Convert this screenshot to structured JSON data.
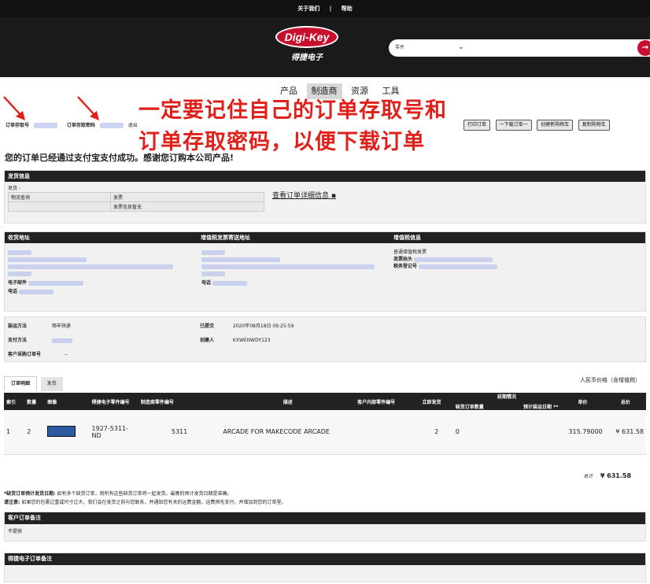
{
  "topbar": {
    "about": "关于我们",
    "sep": "|",
    "help": "帮助"
  },
  "logo": {
    "brand": "Digi-Key",
    "sub": "得捷电子"
  },
  "search": {
    "category": "零件",
    "chevron": "⌄",
    "button": "→"
  },
  "nav": {
    "items": [
      "产品",
      "制造商",
      "资源",
      "工具"
    ]
  },
  "annotation": {
    "line1": "一定要记住自己的订单存取号和",
    "line2": "订单存取密码，以便下载订单"
  },
  "account": {
    "order_access_label": "订单存取号",
    "order_password_label": "订单存取密码",
    "logout": "退出"
  },
  "actions": {
    "print": "打印订单",
    "download": "一下载订单一",
    "create_cart": "创建新购物车",
    "copy_cart": "复制购物车"
  },
  "success_message": "您的订单已经通过支付宝支付成功。感谢您订购本公司产品!",
  "shipping_info": {
    "header": "发货信息",
    "row1": "发货 -",
    "logistics": "物流查询",
    "invoice": "发票",
    "invoice_none": "发票信息暂无",
    "detail_link": "查看订单详细信息"
  },
  "address": {
    "headers": [
      "收货地址",
      "增值税发票寄送地址",
      "增值税信息"
    ],
    "email_label": "电子邮件",
    "phone_label": "电话",
    "phone2_label": "电话",
    "vat_type": "普通增值税发票",
    "invoice_title_label": "发票抬头",
    "tax_id_label": "税务登记号"
  },
  "order_meta": {
    "ship_method_label": "装运方法",
    "ship_method": "顺丰快递",
    "pay_method_label": "支付方法",
    "submitted_label": "已提交",
    "submitted": "2020年08月18日 09:25:59",
    "creator_label": "创建人",
    "creator": "KXWENWDY123",
    "po_label": "客户采购订单号",
    "po": "--"
  },
  "tabs": [
    "订单明细",
    "发货"
  ],
  "currency_note": "人民币价格（含增值税）",
  "table": {
    "headers": [
      "索引",
      "数量",
      "图像",
      "得捷电子零件编号",
      "制造商零件编号",
      "描述",
      "客户内部零件编号",
      "立即发货",
      "延期情况",
      "单价",
      "总价"
    ],
    "sub_headers": [
      "缺货订单数量",
      "预计装运日期 **"
    ],
    "rows": [
      {
        "index": "1",
        "qty": "2",
        "dk_part": "1927-5311-ND",
        "mfr_part": "5311",
        "desc": "ARCADE FOR MAKECODE ARCADE",
        "ship_now": "2",
        "backorder": "0",
        "unit": "315.79000",
        "total": "¥ 631.58"
      }
    ]
  },
  "grand_total": {
    "label": "总计",
    "value": "¥ 631.58"
  },
  "notes": {
    "backorder_label": "*缺货订单预计发货日期:",
    "backorder_text": "如有多个缺货订单，则所有这些缺货订单将一起发货。最晚的预计发货日期是准确。",
    "attention_label": "请注意:",
    "attention_text": "如果您的包裹过重或尺寸过大，我们会在发货之前与您联系，并通知您有关的运费金额。运费预先支付，并增加到您的订单里。"
  },
  "customer_notes": {
    "header": "客户订单备注",
    "body": "不提供"
  },
  "dk_notes": {
    "header": "得捷电子订单备注"
  },
  "colors": {
    "accent": "#c8102e",
    "annotation": "#e0201b",
    "dark": "#222222"
  }
}
